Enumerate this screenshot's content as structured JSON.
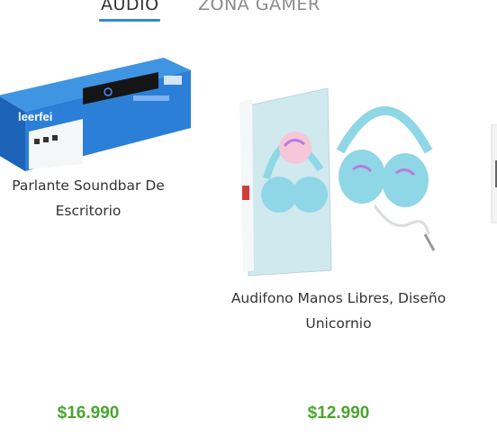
{
  "tabs": [
    {
      "label": "AUDIO",
      "active": true
    },
    {
      "label": "ZONA GAMER",
      "active": false
    }
  ],
  "colors": {
    "accent_underline": "#2f8bd6",
    "price": "#4aa62e",
    "text": "#333333"
  },
  "products": [
    {
      "image_label": "soundbar-image",
      "brand_text": "leerfei",
      "title": "Parlante Soundbar De Escritorio",
      "price": "$16.990"
    },
    {
      "image_label": "unicorn-headphones-image",
      "title": "Audifono Manos Libres, Diseño Unicornio",
      "price": "$12.990"
    },
    {
      "image_label": "partial-product-image"
    }
  ]
}
